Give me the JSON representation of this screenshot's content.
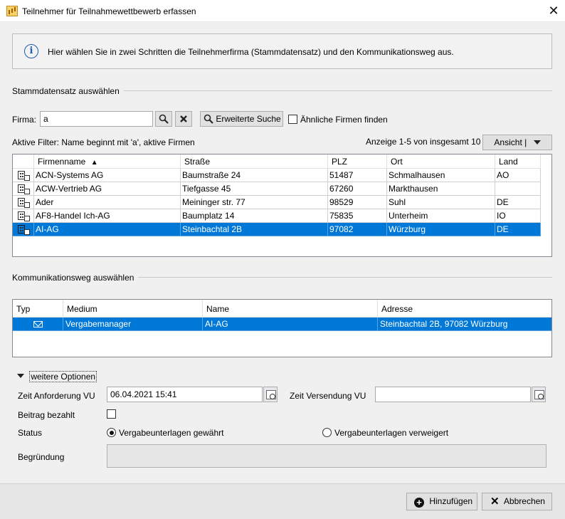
{
  "window": {
    "title": "Teilnehmer für Teilnahmewettbewerb erfassen",
    "close_glyph": "✕"
  },
  "info": {
    "text": "Hier wählen Sie in zwei Schritten die Teilnehmerfirma (Stammdatensatz) und den Kommunikationsweg aus."
  },
  "stamm": {
    "title": "Stammdatensatz auswählen",
    "firma_label": "Firma:",
    "firma_value": "a",
    "search_icon": "magnifier-icon",
    "clear_icon": "x-icon",
    "erweiterte_suche_label": "Erweiterte Suche",
    "aehnliche_label": "Ähnliche Firmen finden",
    "aehnliche_checked": false,
    "filter_text": "Aktive Filter: Name beginnt mit 'a',  aktive Firmen",
    "anzeige_text": "Anzeige 1-5 von insgesamt 10",
    "ansicht_label": "Ansicht |",
    "columns": [
      "Firmenname",
      "Straße",
      "PLZ",
      "Ort",
      "Land"
    ],
    "sort_indicator": "▲",
    "rows": [
      {
        "name": "ACN-Systems AG",
        "strasse": "Baumstraße 24",
        "plz": "51487",
        "ort": "Schmalhausen",
        "land": "AO",
        "selected": false
      },
      {
        "name": "ACW-Vertrieb AG",
        "strasse": "Tiefgasse 45",
        "plz": "67260",
        "ort": "Markthausen",
        "land": "",
        "selected": false
      },
      {
        "name": "Ader",
        "strasse": "Meininger str. 77",
        "plz": "98529",
        "ort": "Suhl",
        "land": "DE",
        "selected": false
      },
      {
        "name": "AF8-Handel Ich-AG",
        "strasse": "Baumplatz 14",
        "plz": "75835",
        "ort": "Unterheim",
        "land": "IO",
        "selected": false
      },
      {
        "name": "AI-AG",
        "strasse": "Steinbachtal 2B",
        "plz": "97082",
        "ort": "Würzburg",
        "land": "DE",
        "selected": true
      }
    ]
  },
  "komm": {
    "title": "Kommunikationsweg auswählen",
    "columns": [
      "Typ",
      "Medium",
      "Name",
      "Adresse"
    ],
    "rows": [
      {
        "typ_icon": "envelope-icon",
        "medium": "Vergabemanager",
        "name": "AI-AG",
        "adresse": "Steinbachtal 2B, 97082 Würzburg",
        "selected": true
      }
    ]
  },
  "options": {
    "toggle_label": "weitere Optionen",
    "zeit_anforderung_label": "Zeit Anforderung VU",
    "zeit_anforderung_value": "06.04.2021 15:41",
    "zeit_versendung_label": "Zeit Versendung VU",
    "zeit_versendung_value": "",
    "beitrag_label": "Beitrag bezahlt",
    "beitrag_checked": false,
    "status_label": "Status",
    "status_option1": "Vergabeunterlagen gewährt",
    "status_option2": "Vergabeunterlagen verweigert",
    "status_selected": "Vergabeunterlagen gewährt",
    "begruendung_label": "Begründung",
    "begruendung_value": ""
  },
  "footer": {
    "hinzufuegen_label": "Hinzufügen",
    "abbrechen_label": "Abbrechen"
  },
  "colors": {
    "selection": "#0078d7",
    "info_icon": "#1a5fb4",
    "dialog_bg": "#f0f0f0"
  }
}
